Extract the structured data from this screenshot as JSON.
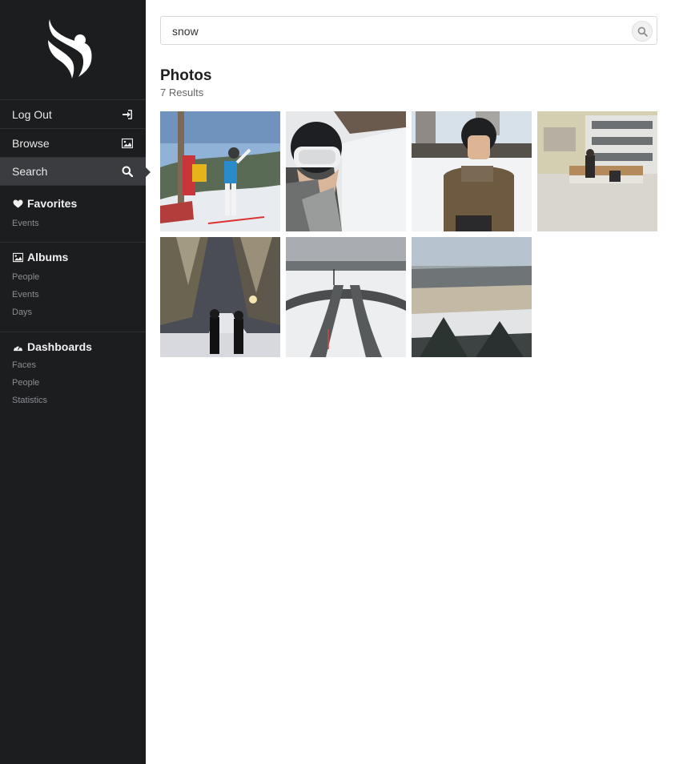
{
  "sidebar": {
    "nav": [
      {
        "label": "Log Out",
        "icon": "sign-in-icon"
      },
      {
        "label": "Browse",
        "icon": "image-icon"
      },
      {
        "label": "Search",
        "icon": "search-icon",
        "active": true
      }
    ],
    "sections": [
      {
        "title": "Favorites",
        "icon": "heart-icon",
        "links": [
          "Events"
        ]
      },
      {
        "title": "Albums",
        "icon": "image-icon",
        "links": [
          "People",
          "Events",
          "Days"
        ]
      },
      {
        "title": "Dashboards",
        "icon": "dashboard-icon",
        "links": [
          "Faces",
          "People",
          "Statistics"
        ]
      }
    ]
  },
  "search": {
    "value": "snow"
  },
  "results": {
    "title": "Photos",
    "count": "7 Results",
    "photos": [
      {
        "name": "photo-skier-on-slope"
      },
      {
        "name": "photo-selfie-goggles"
      },
      {
        "name": "photo-child-helmet"
      },
      {
        "name": "photo-bench-courtyard"
      },
      {
        "name": "photo-snowy-forest-night"
      },
      {
        "name": "photo-snowy-roads"
      },
      {
        "name": "photo-snowy-town"
      }
    ]
  },
  "colors": {
    "sidebar_bg": "#1c1d1f",
    "active_bg": "#3a3c40",
    "text_muted": "#8a8d92"
  }
}
